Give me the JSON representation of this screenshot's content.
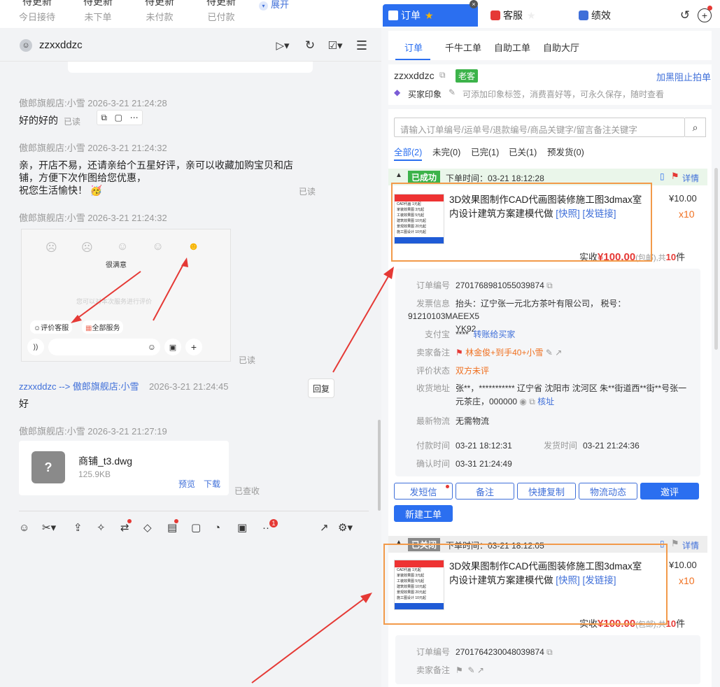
{
  "stats": [
    {
      "value": "待更新",
      "label": "今日接待"
    },
    {
      "value": "待更新",
      "label": "未下单"
    },
    {
      "value": "待更新",
      "label": "未付款"
    },
    {
      "value": "待更新",
      "label": "已付款"
    }
  ],
  "stats_expand": "展开",
  "chat": {
    "username": "zzxxddzc",
    "messages": [
      {
        "meta": "傲郎旗舰店:小雪    2026-3-21 21:24:28",
        "text": "好的好的",
        "read": "已读"
      },
      {
        "meta": "傲郎旗舰店:小雪    2026-3-21 21:24:32",
        "line1": "亲，开店不易，还请亲给个五星好评，亲可以收藏加购宝贝和店",
        "line2": "铺，方便下次作图给您优惠，",
        "line3": "祝您生活愉快！",
        "read": "已读"
      },
      {
        "meta": "傲郎旗舰店:小雪    2026-3-21 21:24:32",
        "read": "已读"
      },
      {
        "meta_from": "zzxxddzc --> 傲郎旗舰店:小雪",
        "meta_time": "2026-3-21 21:24:45",
        "text": "好",
        "reply": "回复"
      },
      {
        "meta": "傲郎旗舰店:小雪    2026-3-21 21:27:19",
        "read": "已查收"
      }
    ],
    "screenshot_img": {
      "rating_label": "很满意",
      "eval_label": "评价客服",
      "all_service": "全部服务",
      "hint": "您可以对本次服务进行评价"
    },
    "file": {
      "name": "商铺_t3.dwg",
      "size": "125.9KB",
      "preview": "预览",
      "download": "下载"
    },
    "toolbar_badge": "1"
  },
  "right": {
    "top_tabs": [
      "订单",
      "客服",
      "绩效"
    ],
    "sub_tabs": [
      "订单",
      "千牛工单",
      "自助工单",
      "自助大厅"
    ],
    "buyer": {
      "name": "zzxxddzc",
      "tag": "老客",
      "block": "加黑阻止拍单",
      "impression_label": "买家印象",
      "impression_hint": "可添加印象标签，消费喜好等，可永久保存，随时查看"
    },
    "search_placeholder": "请输入订单编号/运单号/退款编号/商品关键字/留言备注关键字",
    "filters": [
      "全部(2)",
      "未完(0)",
      "已完(1)",
      "已关(1)",
      "预发货(0)"
    ],
    "order1": {
      "status": "已成功",
      "time": "下单时间：03-21 18:12:28",
      "detail": "详情",
      "title1": "3D效果图制作CAD代画图装修施工图3dmax室",
      "title2": "内设计建筑方案建模代做",
      "snapshot": "[快照]",
      "send_link": "[发链接]",
      "price": "¥10.00",
      "qty": "x10",
      "total_prefix": "实收",
      "total": "¥100.00",
      "total_suffix": "(包邮),共",
      "count": "10",
      "count_unit": "件",
      "rows": {
        "order_no_label": "订单编号",
        "order_no": "2701768981055039874",
        "invoice_label": "发票信息",
        "invoice1": "抬头：辽宁张一元北方茶叶有限公司，  税号：91210103MAEEX5",
        "invoice2": "YK92",
        "alipay_label": "支付宝",
        "alipay": "****",
        "alipay_link": "转账给买家",
        "memo_label": "卖家备注",
        "memo": "林金俊+到手40+小雪",
        "eval_label": "评价状态",
        "eval": "双方未评",
        "addr_label": "收货地址",
        "addr1": "张**，*********** 辽宁省 沈阳市 沈河区 朱**街道西**街**号张一",
        "addr2": "元茶庄，000000",
        "addr_check": "核址",
        "logistics_label": "最新物流",
        "logistics": "无需物流",
        "pay_time_label": "付款时间",
        "pay_time": "03-21 18:12:31",
        "ship_time_label": "发货时间",
        "ship_time": "03-21 21:24:36",
        "confirm_label": "确认时间",
        "confirm_time": "03-31 21:24:49"
      },
      "buttons": [
        "发短信",
        "备注",
        "快捷复制",
        "物流动态",
        "邀评"
      ],
      "new_ticket": "新建工单"
    },
    "order2": {
      "status": "已关闭",
      "time": "下单时间：03-21 18:12:05",
      "detail": "详情",
      "title1": "3D效果图制作CAD代画图装修施工图3dmax室",
      "title2": "内设计建筑方案建模代做",
      "snapshot": "[快照]",
      "send_link": "[发链接]",
      "price": "¥10.00",
      "qty": "x10",
      "total_prefix": "实收",
      "total": "¥100.00",
      "total_suffix": "(包邮),共",
      "count": "10",
      "count_unit": "件",
      "order_no_label": "订单编号",
      "order_no": "2701764230048039874",
      "memo_label": "卖家备注"
    },
    "thumb_lines": [
      "CAD代画  1元起",
      "家装效果图  3元起",
      "工装效果图  5元起",
      "建筑效果图  10元起",
      "景观效果图  20元起",
      "施工图设计  10元起"
    ]
  },
  "colors": {
    "accent": "#2b6ff0",
    "orange": "#f29a4a",
    "red": "#e53935",
    "green": "#3cb34a"
  }
}
